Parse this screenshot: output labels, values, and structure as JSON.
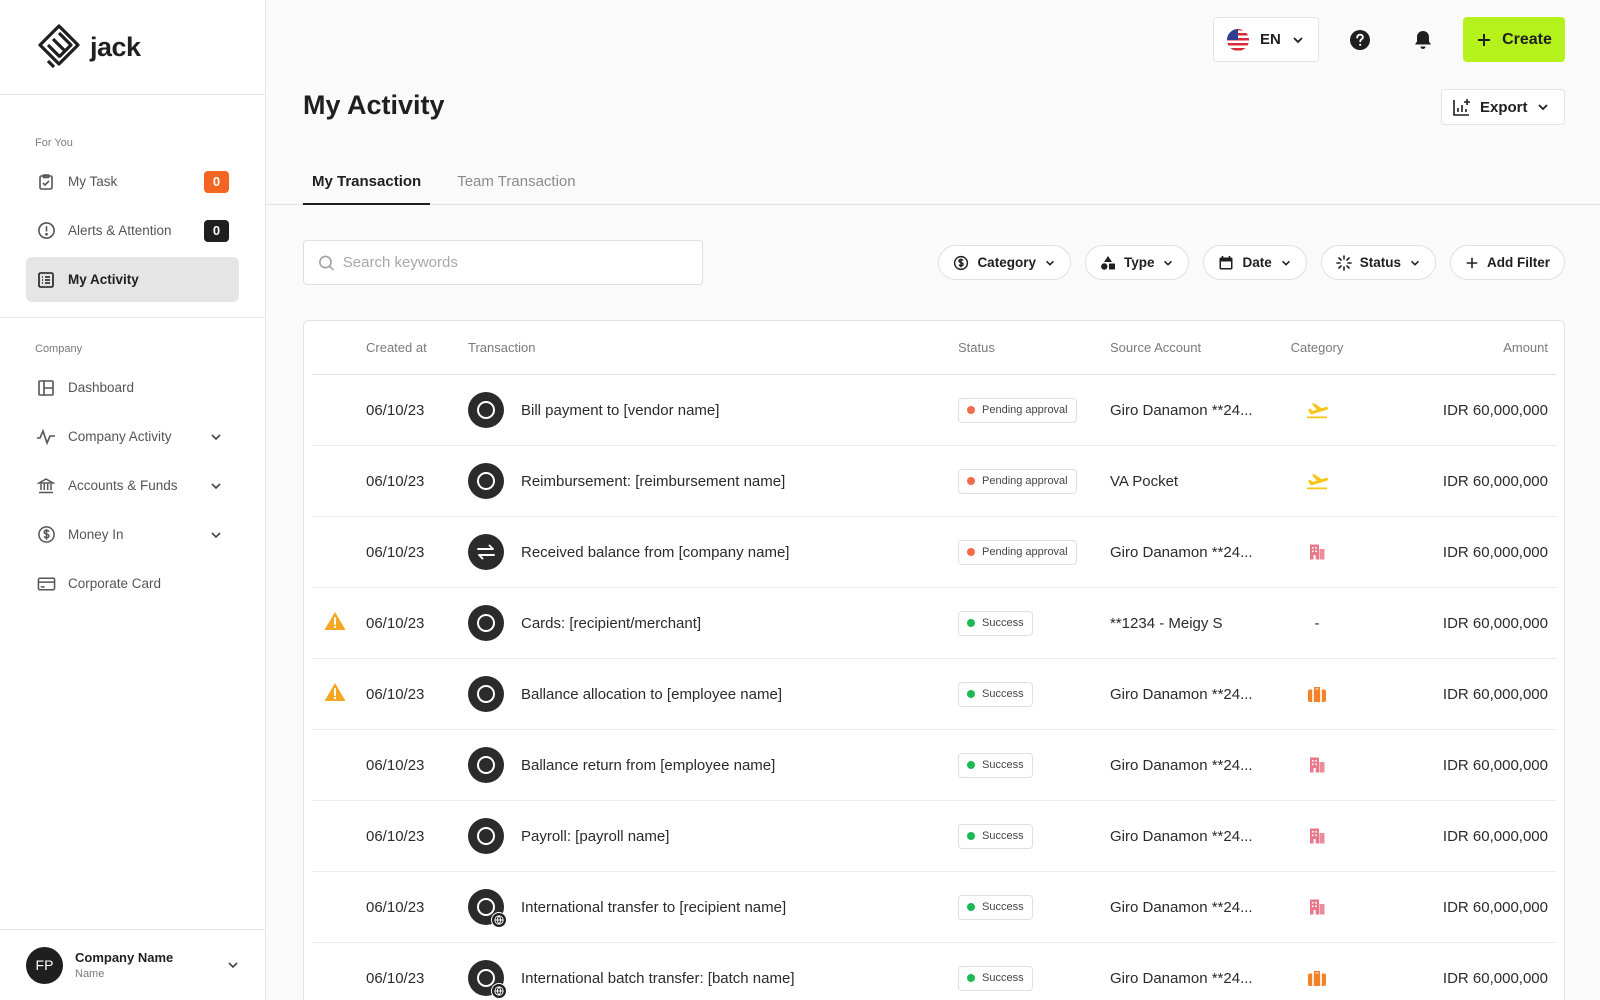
{
  "app": {
    "name": "jack"
  },
  "sidebar": {
    "for_you_title": "For You",
    "company_title": "Company",
    "for_you": [
      {
        "label": "My Task",
        "icon": "clipboard-check-icon",
        "badge": "0",
        "badge_color": "#f26522"
      },
      {
        "label": "Alerts & Attention",
        "icon": "alert-circle-icon",
        "badge": "0",
        "badge_color": "#1f1f1f"
      },
      {
        "label": "My Activity",
        "icon": "list-icon",
        "active": true
      }
    ],
    "company": [
      {
        "label": "Dashboard",
        "icon": "layout-icon"
      },
      {
        "label": "Company Activity",
        "icon": "activity-icon",
        "expandable": true
      },
      {
        "label": "Accounts & Funds",
        "icon": "bank-icon",
        "expandable": true
      },
      {
        "label": "Money In",
        "icon": "dollar-circle-icon",
        "expandable": true
      },
      {
        "label": "Corporate Card",
        "icon": "credit-card-icon"
      }
    ],
    "footer": {
      "initials": "FP",
      "name": "Company Name",
      "sub": "Name"
    }
  },
  "topbar": {
    "language": "EN",
    "create_label": "Create"
  },
  "header": {
    "title": "My Activity",
    "export_label": "Export"
  },
  "tabs": [
    {
      "label": "My Transaction",
      "active": true
    },
    {
      "label": "Team Transaction",
      "active": false
    }
  ],
  "search": {
    "placeholder": "Search keywords",
    "value": ""
  },
  "filters": [
    {
      "label": "Category",
      "icon": "dollar-circle-icon"
    },
    {
      "label": "Type",
      "icon": "shapes-icon"
    },
    {
      "label": "Date",
      "icon": "calendar-icon"
    },
    {
      "label": "Status",
      "icon": "loader-icon"
    }
  ],
  "add_filter_label": "Add Filter",
  "table": {
    "columns": [
      "Created at",
      "Transaction",
      "Status",
      "Source Account",
      "Category",
      "Amount"
    ],
    "rows": [
      {
        "warn": false,
        "date": "06/10/23",
        "icon": "ring",
        "transaction": "Bill payment to [vendor name]",
        "status": "Pending approval",
        "status_color": "#f26b4a",
        "source": "Giro Danamon **24...",
        "category": "plane-icon",
        "amount": "IDR 60,000,000"
      },
      {
        "warn": false,
        "date": "06/10/23",
        "icon": "ring",
        "transaction": "Reimbursement: [reimbursement name]",
        "status": "Pending approval",
        "status_color": "#f26b4a",
        "source": "VA Pocket",
        "category": "plane-icon",
        "amount": "IDR 60,000,000"
      },
      {
        "warn": false,
        "date": "06/10/23",
        "icon": "swap",
        "transaction": "Received balance from [company name]",
        "status": "Pending approval",
        "status_color": "#f26b4a",
        "source": "Giro Danamon **24...",
        "category": "building-icon",
        "amount": "IDR 60,000,000"
      },
      {
        "warn": true,
        "date": "06/10/23",
        "icon": "ring",
        "transaction": "Cards: [recipient/merchant]",
        "status": "Success",
        "status_color": "#1db954",
        "source": "**1234 - Meigy S",
        "category": "-",
        "amount": "IDR 60,000,000"
      },
      {
        "warn": true,
        "date": "06/10/23",
        "icon": "ring",
        "transaction": "Ballance allocation to [employee name]",
        "status": "Success",
        "status_color": "#1db954",
        "source": "Giro Danamon **24...",
        "category": "briefcase-icon",
        "amount": "IDR 60,000,000"
      },
      {
        "warn": false,
        "date": "06/10/23",
        "icon": "ring",
        "transaction": "Ballance return from [employee name]",
        "status": "Success",
        "status_color": "#1db954",
        "source": "Giro Danamon **24...",
        "category": "building-icon",
        "amount": "IDR 60,000,000"
      },
      {
        "warn": false,
        "date": "06/10/23",
        "icon": "ring",
        "transaction": "Payroll: [payroll name]",
        "status": "Success",
        "status_color": "#1db954",
        "source": "Giro Danamon **24...",
        "category": "building-icon",
        "amount": "IDR 60,000,000"
      },
      {
        "warn": false,
        "date": "06/10/23",
        "icon": "globe",
        "transaction": "International transfer to [recipient name]",
        "status": "Success",
        "status_color": "#1db954",
        "source": "Giro Danamon **24...",
        "category": "building-icon",
        "amount": "IDR 60,000,000"
      },
      {
        "warn": false,
        "date": "06/10/23",
        "icon": "globe",
        "transaction": "International batch transfer: [batch name]",
        "status": "Success",
        "status_color": "#1db954",
        "source": "Giro Danamon **24...",
        "category": "briefcase-icon",
        "amount": "IDR 60,000,000"
      }
    ]
  },
  "colors": {
    "accent": "#b5f21c",
    "warning": "#f5a623",
    "plane": "#f5c518",
    "building": "#e8788a",
    "briefcase": "#f2822a"
  }
}
